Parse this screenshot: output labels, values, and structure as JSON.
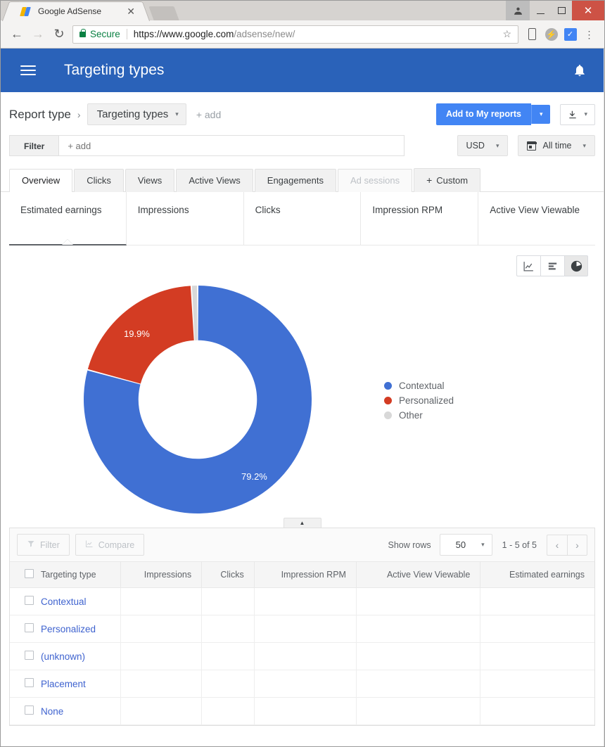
{
  "browser": {
    "tab_title": "Google AdSense",
    "tab_close": "✕",
    "back": "←",
    "forward": "→",
    "reload": "↻",
    "secure_label": "Secure",
    "url_scheme": "https://www.google.com",
    "url_path": "/adsense/new/",
    "star": "☆",
    "bolt": "⚡",
    "checkmark": "✓",
    "menu": "⋮",
    "minimize": "–",
    "maximize": "□",
    "close": "✕",
    "profile": "👤"
  },
  "appbar": {
    "title": "Targeting types",
    "menu_icon": "hamburger-icon",
    "bell_icon": "notifications-bell-icon"
  },
  "report_row": {
    "label": "Report type",
    "chevron": "›",
    "chip": "Targeting types",
    "chip_caret": "▾",
    "add": "+ add",
    "primary_button": "Add to My reports",
    "primary_caret": "▾",
    "download_icon": "⬇",
    "download_caret": "▾"
  },
  "filter_row": {
    "filter_label": "Filter",
    "filter_placeholder": "+ add",
    "filter_value": "",
    "currency": "USD",
    "currency_caret": "▾",
    "date_range": "All time",
    "date_caret": "▾"
  },
  "tabs": [
    {
      "label": "Overview",
      "state": "active"
    },
    {
      "label": "Clicks",
      "state": "normal"
    },
    {
      "label": "Views",
      "state": "normal"
    },
    {
      "label": "Active Views",
      "state": "normal"
    },
    {
      "label": "Engagements",
      "state": "normal"
    },
    {
      "label": "Ad sessions",
      "state": "disabled"
    },
    {
      "label": "Custom",
      "state": "add"
    }
  ],
  "metric_cards": [
    {
      "label": "Estimated earnings",
      "value": "",
      "selected": true
    },
    {
      "label": "Impressions",
      "value": "",
      "selected": false
    },
    {
      "label": "Clicks",
      "value": "",
      "selected": false
    },
    {
      "label": "Impression RPM",
      "value": "",
      "selected": false
    },
    {
      "label": "Active View Viewable",
      "value": "",
      "selected": false
    }
  ],
  "chart_toolbar": [
    {
      "name": "line-chart-button",
      "icon": "line-chart-icon",
      "active": false
    },
    {
      "name": "bar-chart-button",
      "icon": "bar-chart-icon",
      "active": false
    },
    {
      "name": "pie-chart-button",
      "icon": "pie-chart-icon",
      "active": true
    }
  ],
  "chart_data": {
    "type": "pie",
    "variant": "donut",
    "title": "",
    "metric": "Estimated earnings",
    "categories": [
      "Contextual",
      "Personalized",
      "Other"
    ],
    "values": [
      79.2,
      19.9,
      0.9
    ],
    "value_labels": [
      "79.2%",
      "19.9%",
      ""
    ],
    "colors": [
      "#4070d3",
      "#d33c23",
      "#d8d8d8"
    ],
    "legend": [
      "Contextual",
      "Personalized",
      "Other"
    ],
    "legend_position": "right",
    "start_angle_deg": 0,
    "direction": "clockwise",
    "inner_radius_ratio": 0.52,
    "units": "percent"
  },
  "collapse_handle": {
    "icon": "▲"
  },
  "table_toolbar": {
    "filter": "Filter",
    "filter_icon": "funnel-icon",
    "compare": "Compare",
    "compare_icon": "compare-chart-icon",
    "show_rows_label": "Show rows",
    "rows_per_page": "50",
    "rows_caret": "▾",
    "range": "1 - 5 of 5",
    "prev": "‹",
    "next": "›"
  },
  "table": {
    "columns": [
      "Targeting type",
      "Impressions",
      "Clicks",
      "Impression RPM",
      "Active View Viewable",
      "Estimated earnings"
    ],
    "rows": [
      {
        "name": "Contextual",
        "impressions": "",
        "clicks": "",
        "rpm": "",
        "viewable": "",
        "earnings": ""
      },
      {
        "name": "Personalized",
        "impressions": "",
        "clicks": "",
        "rpm": "",
        "viewable": "",
        "earnings": ""
      },
      {
        "name": "(unknown)",
        "impressions": "",
        "clicks": "",
        "rpm": "",
        "viewable": "",
        "earnings": ""
      },
      {
        "name": "Placement",
        "impressions": "",
        "clicks": "",
        "rpm": "",
        "viewable": "",
        "earnings": ""
      },
      {
        "name": "None",
        "impressions": "",
        "clicks": "",
        "rpm": "",
        "viewable": "",
        "earnings": ""
      }
    ]
  },
  "colors": {
    "brand_blue": "#2a62b9",
    "accent_blue": "#4285f4",
    "link_blue": "#3f63cf",
    "chart_blue": "#4070d3",
    "chart_red": "#d33c23",
    "chart_gray": "#d8d8d8"
  }
}
